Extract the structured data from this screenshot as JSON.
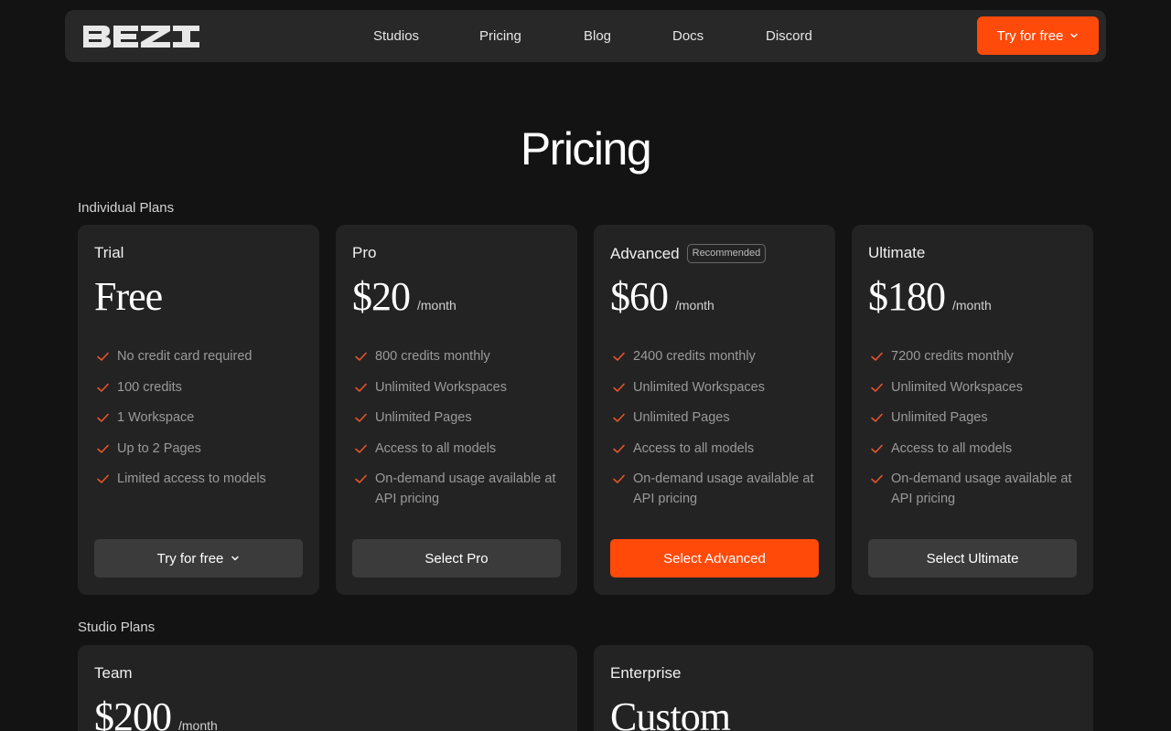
{
  "nav": {
    "logo_text": "BEZI",
    "links": [
      "Studios",
      "Pricing",
      "Blog",
      "Docs",
      "Discord"
    ],
    "cta_label": "Try for free"
  },
  "page": {
    "title": "Pricing",
    "individual_label": "Individual Plans",
    "studio_label": "Studio Plans"
  },
  "plans": [
    {
      "name": "Trial",
      "price": "Free",
      "period": "",
      "badge": "",
      "features": [
        "No credit card required",
        "100 credits",
        "1 Workspace",
        "Up to 2 Pages",
        "Limited access to models"
      ],
      "button": "Try for free"
    },
    {
      "name": "Pro",
      "price": "$20",
      "period": "/month",
      "badge": "",
      "features": [
        "800 credits monthly",
        "Unlimited Workspaces",
        "Unlimited Pages",
        "Access to all models",
        "On-demand usage available at API pricing"
      ],
      "button": "Select Pro"
    },
    {
      "name": "Advanced",
      "price": "$60",
      "period": "/month",
      "badge": "Recommended",
      "features": [
        "2400 credits monthly",
        "Unlimited Workspaces",
        "Unlimited Pages",
        "Access to all models",
        "On-demand usage available at API pricing"
      ],
      "button": "Select Advanced"
    },
    {
      "name": "Ultimate",
      "price": "$180",
      "period": "/month",
      "badge": "",
      "features": [
        "7200 credits monthly",
        "Unlimited Workspaces",
        "Unlimited Pages",
        "Access to all models",
        "On-demand usage available at API pricing"
      ],
      "button": "Select Ultimate"
    }
  ],
  "studio_plans": [
    {
      "name": "Team",
      "price": "$200",
      "period": "/month"
    },
    {
      "name": "Enterprise",
      "price": "Custom",
      "period": ""
    }
  ],
  "colors": {
    "accent": "#ff4a0a",
    "check": "#e8552a",
    "background": "#131313",
    "card": "#232323"
  },
  "icons": {
    "check": "check-icon",
    "chevron": "chevron-down-icon"
  }
}
